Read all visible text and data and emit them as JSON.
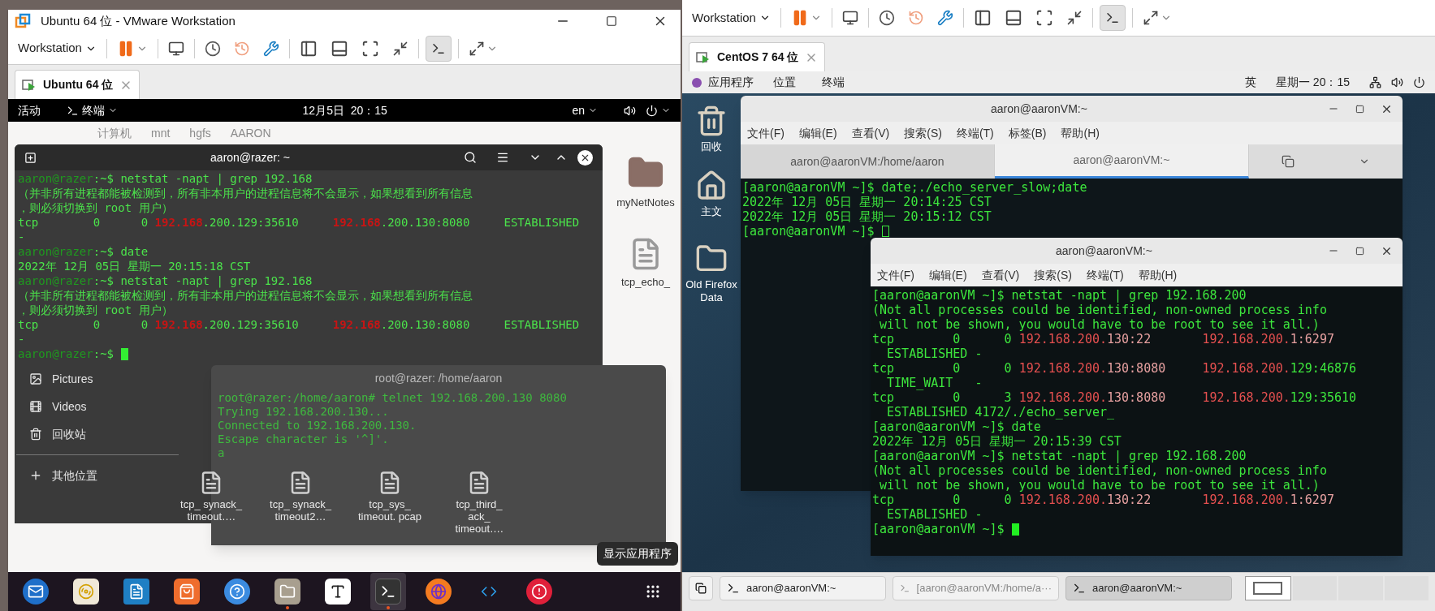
{
  "left_window": {
    "title": "Ubuntu 64 位 - VMware Workstation",
    "menu": "Workstation",
    "tab": {
      "label": "Ubuntu 64 位",
      "selected": true
    },
    "topbar": {
      "activities": "活动",
      "app": "终端",
      "clock": "12月5日  20：15",
      "language": "en"
    },
    "file_manager": {
      "path": [
        "计算机",
        "mnt",
        "hgfs",
        "AARON"
      ],
      "sidebar": [
        {
          "kind": "pictures",
          "label": "Pictures"
        },
        {
          "kind": "videos",
          "label": "Videos"
        },
        {
          "kind": "trash",
          "label": "回收站"
        },
        {
          "kind": "other",
          "label": "其他位置"
        }
      ],
      "side_files": [
        {
          "kind": "folder",
          "name": "myNetNotes"
        },
        {
          "kind": "document",
          "name": "tcp_echo_"
        }
      ],
      "files": [
        {
          "name": "tcp_ synack_ timeout…."
        },
        {
          "name": "tcp_ synack_ timeout2…"
        },
        {
          "name": "tcp_sys_ timeout. pcap"
        },
        {
          "name": "tcp_third_ ack_ timeout…."
        }
      ]
    },
    "root_terminal": {
      "title": "root@razer: /home/aaron",
      "lines": [
        "root@razer:/home/aaron# telnet 192.168.200.130 8080",
        "Trying 192.168.200.130...",
        "Connected to 192.168.200.130.",
        "Escape character is '^]'.",
        "a"
      ]
    },
    "terminal": {
      "title": "aaron@razer: ~",
      "focused": true,
      "lines": [
        [
          {
            "kind": "prompt",
            "text": "aaron@razer"
          },
          {
            "kind": "text",
            "text": ":~$ netstat -napt | grep 192.168"
          }
        ],
        "（并非所有进程都能被检测到，所有非本用户的进程信息将不会显示，如果想看到所有信息",
        "，则必须切换到 root 用户）",
        [
          {
            "kind": "text",
            "text": "tcp        0      0 "
          },
          {
            "kind": "address",
            "text": "192.168"
          },
          {
            "kind": "text",
            "text": ".200.129:35610     "
          },
          {
            "kind": "address",
            "text": "192.168"
          },
          {
            "kind": "text",
            "text": ".200.130:8080     ESTABLISHED"
          }
        ],
        "-",
        [
          {
            "kind": "prompt",
            "text": "aaron@razer"
          },
          {
            "kind": "text",
            "text": ":~$ date"
          }
        ],
        "2022年 12月 05日 星期一 20:15:18 CST",
        [
          {
            "kind": "prompt",
            "text": "aaron@razer"
          },
          {
            "kind": "text",
            "text": ":~$ netstat -napt | grep 192.168"
          }
        ],
        "（并非所有进程都能被检测到，所有非本用户的进程信息将不会显示，如果想看到所有信息",
        "，则必须切换到 root 用户）",
        [
          {
            "kind": "text",
            "text": "tcp        0      0 "
          },
          {
            "kind": "address",
            "text": "192.168"
          },
          {
            "kind": "text",
            "text": ".200.129:35610     "
          },
          {
            "kind": "address",
            "text": "192.168"
          },
          {
            "kind": "text",
            "text": ".200.130:8080     ESTABLISHED"
          }
        ],
        "-",
        [
          {
            "kind": "prompt",
            "text": "aaron@razer"
          },
          {
            "kind": "text",
            "text": ":~$"
          }
        ]
      ]
    },
    "tooltip": "显示应用程序",
    "dock": [
      {
        "kind": "mail",
        "running": false,
        "selected": false
      },
      {
        "kind": "music",
        "running": false,
        "selected": false
      },
      {
        "kind": "writer",
        "running": false,
        "selected": false
      },
      {
        "kind": "store",
        "running": false,
        "selected": false
      },
      {
        "kind": "help",
        "running": false,
        "selected": false
      },
      {
        "kind": "files",
        "running": true,
        "selected": false
      },
      {
        "kind": "typora",
        "running": false,
        "selected": false
      },
      {
        "kind": "terminal",
        "running": true,
        "selected": true
      },
      {
        "kind": "browser",
        "running": false,
        "selected": false
      },
      {
        "kind": "code",
        "running": false,
        "selected": false
      },
      {
        "kind": "alert",
        "running": false,
        "selected": false
      },
      {
        "kind": "apps",
        "running": false,
        "selected": false
      }
    ]
  },
  "right_window": {
    "menu": "Workstation",
    "tab": {
      "label": "CentOS 7 64 位",
      "selected": true
    },
    "topbar": {
      "applications": "应用程序",
      "places": "位置",
      "terminal": "终端",
      "input_method": "英",
      "clock": "星期一 20：15"
    },
    "desktop_icons": [
      {
        "kind": "trash",
        "label": "回收"
      },
      {
        "kind": "home",
        "label": "主文"
      },
      {
        "kind": "folder",
        "label": "Old Firefox Data"
      }
    ],
    "terminal_back": {
      "title": "aaron@aaronVM:~",
      "focused": false,
      "menu": [
        "文件(F)",
        "编辑(E)",
        "查看(V)",
        "搜索(S)",
        "终端(T)",
        "标签(B)",
        "帮助(H)"
      ],
      "tabs": [
        {
          "label": "aaron@aaronVM:/home/aaron",
          "selected": false
        },
        {
          "label": "aaron@aaronVM:~",
          "selected": true
        }
      ],
      "lines": [
        "[aaron@aaronVM ~]$ date;./echo_server_slow;date",
        "2022年 12月 05日 星期一 20:14:25 CST",
        "2022年 12月 05日 星期一 20:15:12 CST",
        "[aaron@aaronVM ~]$"
      ]
    },
    "terminal_front": {
      "title": "aaron@aaronVM:~",
      "focused": true,
      "menu": [
        "文件(F)",
        "编辑(E)",
        "查看(V)",
        "搜索(S)",
        "终端(T)",
        "帮助(H)"
      ],
      "lines": [
        "[aaron@aaronVM ~]$ netstat -napt | grep 192.168.200",
        "(Not all processes could be identified, non-owned process info",
        " will not be shown, you would have to be root to see it all.)",
        [
          {
            "kind": "text",
            "text": "tcp        0      0 "
          },
          {
            "kind": "address",
            "text": "192.168.200."
          },
          {
            "kind": "host",
            "text": "130:22       "
          },
          {
            "kind": "address",
            "text": "192.168.200."
          },
          {
            "kind": "host",
            "text": "1:6297"
          }
        ],
        "  ESTABLISHED -",
        [
          {
            "kind": "text",
            "text": "tcp        0      0 "
          },
          {
            "kind": "address",
            "text": "192.168.200."
          },
          {
            "kind": "host",
            "text": "130:8080     "
          },
          {
            "kind": "address",
            "text": "192.168.200."
          },
          {
            "kind": "text",
            "text": "129:46876"
          }
        ],
        "  TIME_WAIT   -",
        [
          {
            "kind": "text",
            "text": "tcp        0      3 "
          },
          {
            "kind": "address",
            "text": "192.168.200."
          },
          {
            "kind": "host",
            "text": "130:8080     "
          },
          {
            "kind": "address",
            "text": "192.168.200."
          },
          {
            "kind": "text",
            "text": "129:35610"
          }
        ],
        "  ESTABLISHED 4172/./echo_server_",
        "[aaron@aaronVM ~]$ date",
        "2022年 12月 05日 星期一 20:15:39 CST",
        "[aaron@aaronVM ~]$ netstat -napt | grep 192.168.200",
        "(Not all processes could be identified, non-owned process info",
        " will not be shown, you would have to be root to see it all.)",
        [
          {
            "kind": "text",
            "text": "tcp        0      0 "
          },
          {
            "kind": "address",
            "text": "192.168.200."
          },
          {
            "kind": "host",
            "text": "130:22       "
          },
          {
            "kind": "address",
            "text": "192.168.200."
          },
          {
            "kind": "host",
            "text": "1:6297"
          }
        ],
        "  ESTABLISHED -",
        "[aaron@aaronVM ~]$"
      ]
    },
    "taskbar": {
      "tasks": [
        {
          "label": "aaron@aaronVM:~",
          "selected": false,
          "minimized": false
        },
        {
          "label": "[aaron@aaronVM:/home/a···",
          "selected": false,
          "minimized": true
        },
        {
          "label": "aaron@aaronVM:~",
          "selected": true,
          "minimized": false
        }
      ],
      "workspaces": [
        {
          "selected": true
        },
        {
          "selected": false
        },
        {
          "selected": false
        },
        {
          "selected": false
        }
      ]
    }
  }
}
